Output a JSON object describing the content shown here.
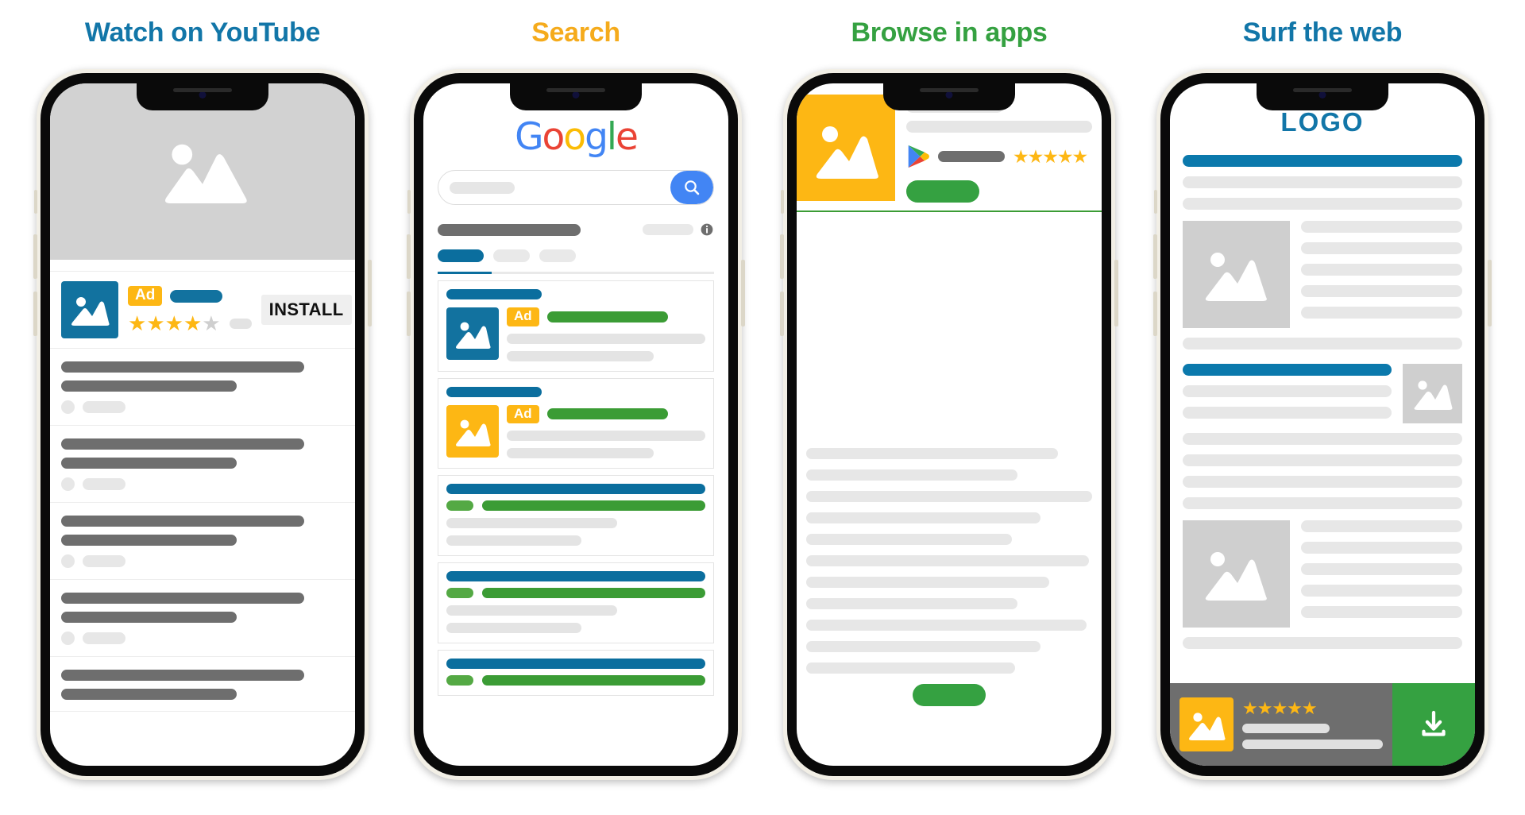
{
  "panels": [
    {
      "id": "youtube",
      "title": "Watch on YouTube",
      "title_color": "#1276a8",
      "ad": {
        "badge": "Ad",
        "install_label": "INSTALL",
        "stars_filled": 4,
        "stars_total": 5,
        "icon_color": "#12729f",
        "icon": "image-placeholder-icon"
      },
      "video": {
        "icon": "image-placeholder-icon",
        "bg": "#d2d2d2"
      },
      "list_rows": 5
    },
    {
      "id": "search",
      "title": "Search",
      "title_color": "#f5ab1c",
      "logo": {
        "text": "Google",
        "letters": [
          "G",
          "o",
          "o",
          "g",
          "l",
          "e"
        ],
        "colors": [
          "#4285F4",
          "#EA4335",
          "#FBBC05",
          "#4285F4",
          "#34A853",
          "#EA4335"
        ]
      },
      "searchbar": {
        "placeholder": "",
        "button_icon": "search-icon",
        "button_color": "#4285F4"
      },
      "info_icon": "info-icon",
      "tabs": [
        {
          "state": "active"
        },
        {
          "state": "idle"
        },
        {
          "state": "idle"
        }
      ],
      "ad_cards": [
        {
          "badge": "Ad",
          "thumb_color": "#12729f",
          "icon": "image-placeholder-icon"
        },
        {
          "badge": "Ad",
          "thumb_color": "#fdb714",
          "icon": "image-placeholder-icon"
        }
      ],
      "organic_cards": 3
    },
    {
      "id": "apps",
      "title": "Browse in apps",
      "title_color": "#35a141",
      "header": {
        "hero_color": "#fdb714",
        "hero_icon": "image-placeholder-icon",
        "store_icon": "google-play-icon",
        "stars_filled": 5,
        "cta_color": "#35a141"
      },
      "divider_color": "#3b9c35",
      "big_image": {
        "icon": "image-placeholder-icon",
        "bg": "#e7e7e7"
      },
      "text_lines": 11,
      "bottom_button_color": "#35a141"
    },
    {
      "id": "web",
      "title": "Surf the web",
      "title_color": "#1276a8",
      "logo_text": "LOGO",
      "logo_color": "#1276a8",
      "accent_bar_color": "#0b79ac",
      "images": [
        "image-placeholder-icon",
        "image-placeholder-icon",
        "image-placeholder-icon"
      ],
      "banner": {
        "bg": "#6e6e6e",
        "icon_color": "#fdb714",
        "icon": "image-placeholder-icon",
        "stars_filled": 5,
        "download_icon": "download-icon",
        "download_color": "#35a141"
      }
    }
  ],
  "glyphs": {
    "star_filled": "★",
    "star_empty": "★"
  }
}
